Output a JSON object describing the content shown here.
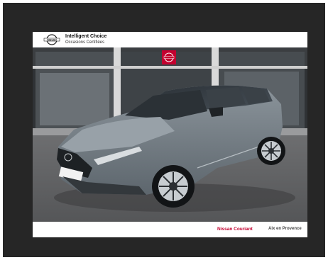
{
  "header": {
    "logo_text": "NISSAN",
    "title": "Intelligent Choice",
    "subtitle": "Occasions Certifiées"
  },
  "footer": {
    "dealer_name": "Nissan Couriant",
    "location": "Aix en Provence"
  },
  "colors": {
    "brand_red": "#c3002f",
    "frame": "#262626"
  }
}
